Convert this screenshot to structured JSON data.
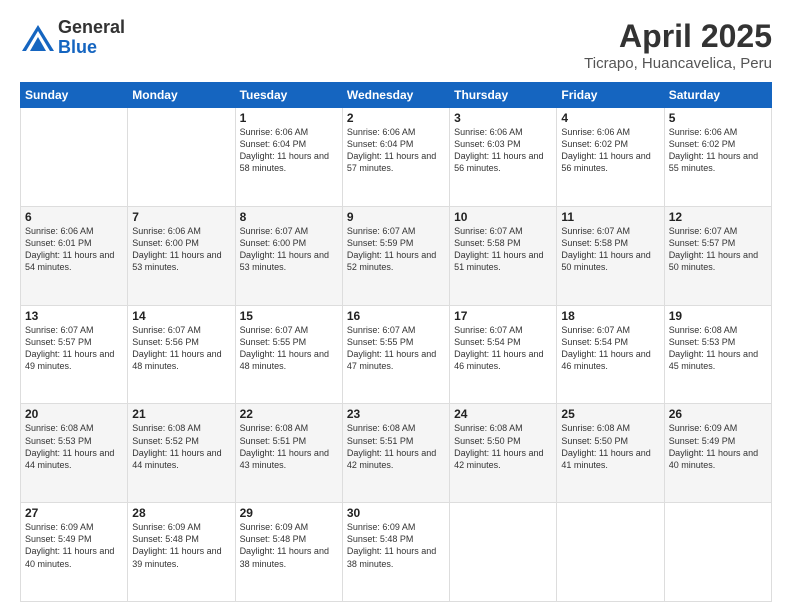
{
  "header": {
    "logo_general": "General",
    "logo_blue": "Blue",
    "title": "April 2025",
    "subtitle": "Ticrapo, Huancavelica, Peru"
  },
  "weekdays": [
    "Sunday",
    "Monday",
    "Tuesday",
    "Wednesday",
    "Thursday",
    "Friday",
    "Saturday"
  ],
  "weeks": [
    [
      {
        "day": "",
        "info": ""
      },
      {
        "day": "",
        "info": ""
      },
      {
        "day": "1",
        "info": "Sunrise: 6:06 AM\nSunset: 6:04 PM\nDaylight: 11 hours and 58 minutes."
      },
      {
        "day": "2",
        "info": "Sunrise: 6:06 AM\nSunset: 6:04 PM\nDaylight: 11 hours and 57 minutes."
      },
      {
        "day": "3",
        "info": "Sunrise: 6:06 AM\nSunset: 6:03 PM\nDaylight: 11 hours and 56 minutes."
      },
      {
        "day": "4",
        "info": "Sunrise: 6:06 AM\nSunset: 6:02 PM\nDaylight: 11 hours and 56 minutes."
      },
      {
        "day": "5",
        "info": "Sunrise: 6:06 AM\nSunset: 6:02 PM\nDaylight: 11 hours and 55 minutes."
      }
    ],
    [
      {
        "day": "6",
        "info": "Sunrise: 6:06 AM\nSunset: 6:01 PM\nDaylight: 11 hours and 54 minutes."
      },
      {
        "day": "7",
        "info": "Sunrise: 6:06 AM\nSunset: 6:00 PM\nDaylight: 11 hours and 53 minutes."
      },
      {
        "day": "8",
        "info": "Sunrise: 6:07 AM\nSunset: 6:00 PM\nDaylight: 11 hours and 53 minutes."
      },
      {
        "day": "9",
        "info": "Sunrise: 6:07 AM\nSunset: 5:59 PM\nDaylight: 11 hours and 52 minutes."
      },
      {
        "day": "10",
        "info": "Sunrise: 6:07 AM\nSunset: 5:58 PM\nDaylight: 11 hours and 51 minutes."
      },
      {
        "day": "11",
        "info": "Sunrise: 6:07 AM\nSunset: 5:58 PM\nDaylight: 11 hours and 50 minutes."
      },
      {
        "day": "12",
        "info": "Sunrise: 6:07 AM\nSunset: 5:57 PM\nDaylight: 11 hours and 50 minutes."
      }
    ],
    [
      {
        "day": "13",
        "info": "Sunrise: 6:07 AM\nSunset: 5:57 PM\nDaylight: 11 hours and 49 minutes."
      },
      {
        "day": "14",
        "info": "Sunrise: 6:07 AM\nSunset: 5:56 PM\nDaylight: 11 hours and 48 minutes."
      },
      {
        "day": "15",
        "info": "Sunrise: 6:07 AM\nSunset: 5:55 PM\nDaylight: 11 hours and 48 minutes."
      },
      {
        "day": "16",
        "info": "Sunrise: 6:07 AM\nSunset: 5:55 PM\nDaylight: 11 hours and 47 minutes."
      },
      {
        "day": "17",
        "info": "Sunrise: 6:07 AM\nSunset: 5:54 PM\nDaylight: 11 hours and 46 minutes."
      },
      {
        "day": "18",
        "info": "Sunrise: 6:07 AM\nSunset: 5:54 PM\nDaylight: 11 hours and 46 minutes."
      },
      {
        "day": "19",
        "info": "Sunrise: 6:08 AM\nSunset: 5:53 PM\nDaylight: 11 hours and 45 minutes."
      }
    ],
    [
      {
        "day": "20",
        "info": "Sunrise: 6:08 AM\nSunset: 5:53 PM\nDaylight: 11 hours and 44 minutes."
      },
      {
        "day": "21",
        "info": "Sunrise: 6:08 AM\nSunset: 5:52 PM\nDaylight: 11 hours and 44 minutes."
      },
      {
        "day": "22",
        "info": "Sunrise: 6:08 AM\nSunset: 5:51 PM\nDaylight: 11 hours and 43 minutes."
      },
      {
        "day": "23",
        "info": "Sunrise: 6:08 AM\nSunset: 5:51 PM\nDaylight: 11 hours and 42 minutes."
      },
      {
        "day": "24",
        "info": "Sunrise: 6:08 AM\nSunset: 5:50 PM\nDaylight: 11 hours and 42 minutes."
      },
      {
        "day": "25",
        "info": "Sunrise: 6:08 AM\nSunset: 5:50 PM\nDaylight: 11 hours and 41 minutes."
      },
      {
        "day": "26",
        "info": "Sunrise: 6:09 AM\nSunset: 5:49 PM\nDaylight: 11 hours and 40 minutes."
      }
    ],
    [
      {
        "day": "27",
        "info": "Sunrise: 6:09 AM\nSunset: 5:49 PM\nDaylight: 11 hours and 40 minutes."
      },
      {
        "day": "28",
        "info": "Sunrise: 6:09 AM\nSunset: 5:48 PM\nDaylight: 11 hours and 39 minutes."
      },
      {
        "day": "29",
        "info": "Sunrise: 6:09 AM\nSunset: 5:48 PM\nDaylight: 11 hours and 38 minutes."
      },
      {
        "day": "30",
        "info": "Sunrise: 6:09 AM\nSunset: 5:48 PM\nDaylight: 11 hours and 38 minutes."
      },
      {
        "day": "",
        "info": ""
      },
      {
        "day": "",
        "info": ""
      },
      {
        "day": "",
        "info": ""
      }
    ]
  ]
}
